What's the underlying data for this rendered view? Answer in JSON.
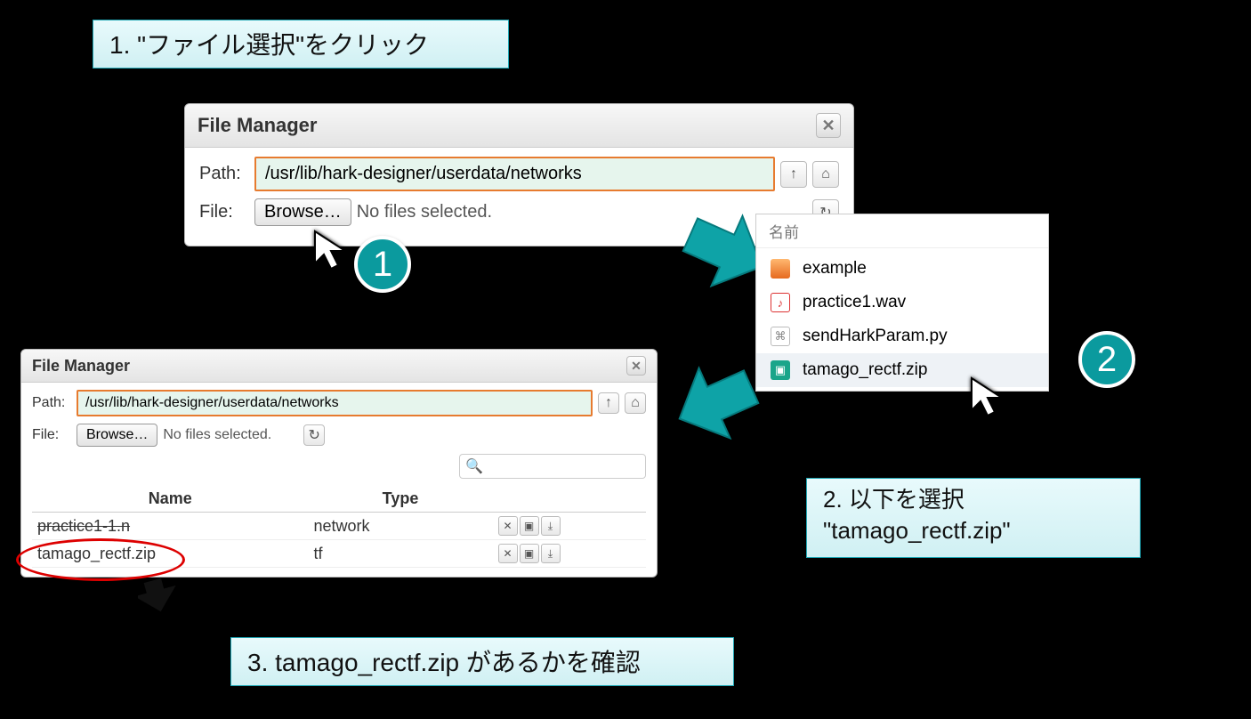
{
  "callouts": {
    "c1": "1. \"ファイル選択\"をクリック",
    "c2a": "2. 以下を選択",
    "c2b": "\"tamago_rectf.zip\"",
    "c3": "3. tamago_rectf.zip があるかを確認"
  },
  "badges": {
    "b1": "1",
    "b2": "2"
  },
  "fm1": {
    "title": "File Manager",
    "path_label": "Path:",
    "path_value": "/usr/lib/hark-designer/userdata/networks",
    "file_label": "File:",
    "browse": "Browse…",
    "nofile": "No files selected."
  },
  "fm2": {
    "title": "File Manager",
    "path_label": "Path:",
    "path_value": "/usr/lib/hark-designer/userdata/networks",
    "file_label": "File:",
    "browse": "Browse…",
    "nofile": "No files selected.",
    "headers": {
      "name": "Name",
      "type": "Type"
    },
    "rows": [
      {
        "name": "practice1-1.n",
        "type": "network",
        "strike": true
      },
      {
        "name": "tamago_rectf.zip",
        "type": "tf",
        "strike": false
      }
    ]
  },
  "browser": {
    "header": "名前",
    "items": [
      {
        "icon": "folder",
        "label": "example",
        "sel": false
      },
      {
        "icon": "audio",
        "label": "practice1.wav",
        "sel": false
      },
      {
        "icon": "script",
        "label": "sendHarkParam.py",
        "sel": false
      },
      {
        "icon": "zip",
        "label": "tamago_rectf.zip",
        "sel": true
      }
    ]
  }
}
